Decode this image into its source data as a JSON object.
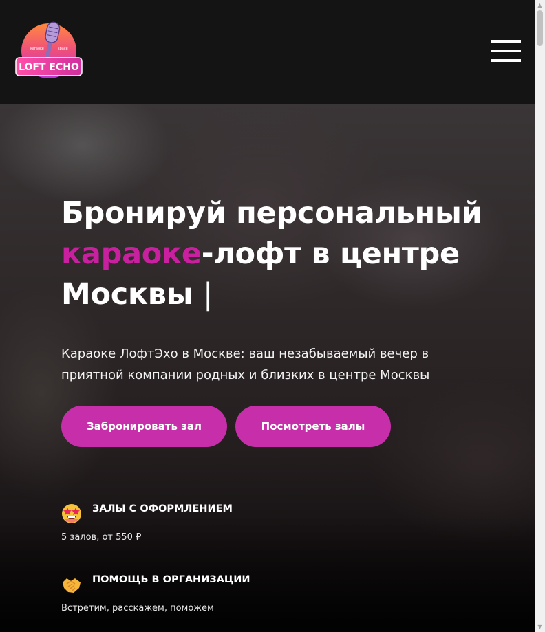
{
  "brand": {
    "logo_text": "LOFT ECHO",
    "logo_small_left": "karaoke",
    "logo_small_right": "space"
  },
  "header": {
    "menu_icon": "hamburger-icon"
  },
  "hero": {
    "title_part1": "Бронируй персональный ",
    "title_accent": "караоке",
    "title_part2": "-лофт в центре Москвы",
    "title_cursor": "|",
    "subtitle": "Караоке ЛофтЭхо в Москве: ваш незабываемый вечер в приятной компании родных и близких в центре Москвы",
    "buttons": {
      "book_label": "Забронировать зал",
      "view_label": "Посмотреть залы"
    },
    "features": [
      {
        "icon": "star-struck-emoji-icon",
        "title": "ЗАЛЫ С ОФОРМЛЕНИЕМ",
        "description": "5 залов, от 550 ₽"
      },
      {
        "icon": "handshake-emoji-icon",
        "title": "ПОМОЩЬ В ОРГАНИЗАЦИИ",
        "description": "Встретим, расскажем, поможем"
      }
    ]
  },
  "colors": {
    "accent": "#c8209e",
    "button": "#c72ea9",
    "header_bg": "#141414"
  }
}
